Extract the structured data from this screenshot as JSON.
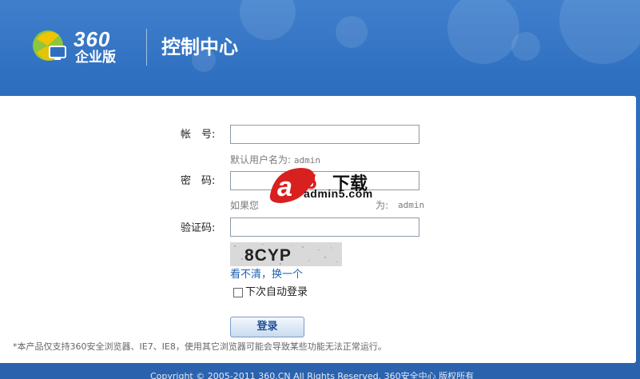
{
  "header": {
    "brand_number": "360",
    "brand_edition": "企业版",
    "title": "控制中心"
  },
  "form": {
    "account_label": "帐　号:",
    "account_value": "",
    "account_hint_prefix": "默认用户名为:",
    "account_hint_value": "admin",
    "password_label": "密　码:",
    "password_value": "",
    "password_hint_prefix": "如果您",
    "password_hint_suffix": "为:",
    "password_hint_value": "admin",
    "captcha_label": "验证码:",
    "captcha_value": "",
    "captcha_image_text": "8CYP",
    "refresh_link": "看不清，换一个",
    "auto_login_label": "下次自动登录",
    "auto_login_checked": false,
    "submit_label": "登录"
  },
  "footer": {
    "notice": "*本产品仅支持360安全浏览器、IE7、IE8，使用其它浏览器可能会导致某些功能无法正常运行。",
    "copyright": "Copyright © 2005-2011 360.CN All Rights Reserved. 360安全中心 版权所有"
  },
  "watermark": {
    "site": "admin5.com",
    "glyph_a": "a",
    "glyph_5": "5",
    "tag": "下载"
  },
  "colors": {
    "header_blue": "#2f6fc0",
    "logo_green": "#8cc63f",
    "logo_yellow": "#f2c300",
    "link_blue": "#1f5fb0",
    "watermark_red": "#d8201f"
  }
}
